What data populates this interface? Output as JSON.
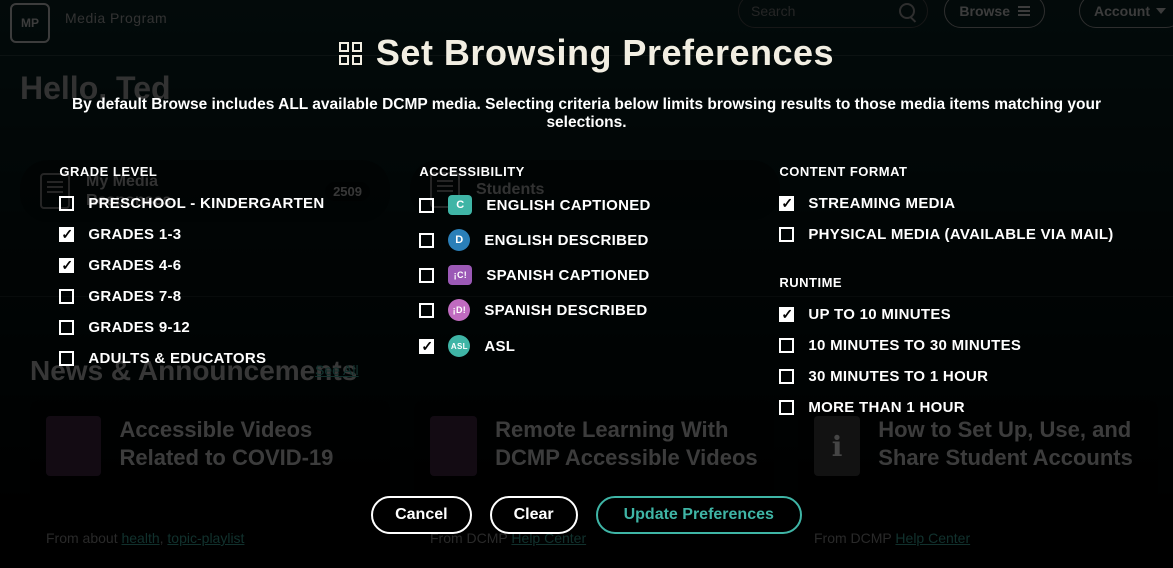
{
  "bg": {
    "logo_text": "MP",
    "brand": "Media Program",
    "search_placeholder": "Search",
    "browse": "Browse",
    "account": "Account",
    "hello": "Hello, Ted",
    "myMedia": {
      "title": "My Media\nResponses",
      "badge": "2509"
    },
    "students": "Students",
    "news_heading": "News & Announcements",
    "see_all": "See All",
    "cards": [
      {
        "title": "Accessible Videos Related to COVID-19",
        "meta_prefix": "From about ",
        "links": [
          "health",
          "topic-playlist"
        ]
      },
      {
        "title": "Remote Learning With DCMP Accessible Videos",
        "meta_prefix": "From DCMP ",
        "links": [
          "Help Center"
        ]
      },
      {
        "title": "How to Set Up, Use, and Share Student Accounts",
        "meta_prefix": "From DCMP ",
        "links": [
          "Help Center"
        ]
      }
    ]
  },
  "modal": {
    "title": "Set Browsing Preferences",
    "description": "By default Browse includes ALL available DCMP media. Selecting criteria below limits browsing results to those media items matching your selections.",
    "grade_level": {
      "heading": "GRADE LEVEL",
      "options": [
        {
          "label": "PRESCHOOL - KINDERGARTEN",
          "checked": false
        },
        {
          "label": "GRADES 1-3",
          "checked": true
        },
        {
          "label": "GRADES 4-6",
          "checked": true
        },
        {
          "label": "GRADES 7-8",
          "checked": false
        },
        {
          "label": "GRADES 9-12",
          "checked": false
        },
        {
          "label": "ADULTS & EDUCATORS",
          "checked": false
        }
      ]
    },
    "accessibility": {
      "heading": "ACCESSIBILITY",
      "options": [
        {
          "label": "ENGLISH CAPTIONED",
          "checked": false,
          "badge": "C",
          "badgeClass": "badge-c"
        },
        {
          "label": "ENGLISH DESCRIBED",
          "checked": false,
          "badge": "D",
          "badgeClass": "badge-d round"
        },
        {
          "label": "SPANISH CAPTIONED",
          "checked": false,
          "badge": "¡C!",
          "badgeClass": "badge-sc"
        },
        {
          "label": "SPANISH DESCRIBED",
          "checked": false,
          "badge": "¡D!",
          "badgeClass": "badge-sd round"
        },
        {
          "label": "ASL",
          "checked": true,
          "badge": "ASL",
          "badgeClass": "badge-asl round"
        }
      ]
    },
    "content_format": {
      "heading": "CONTENT FORMAT",
      "options": [
        {
          "label": "STREAMING MEDIA",
          "checked": true
        },
        {
          "label": "PHYSICAL MEDIA (AVAILABLE VIA MAIL)",
          "checked": false
        }
      ]
    },
    "runtime": {
      "heading": "RUNTIME",
      "options": [
        {
          "label": "UP TO 10 MINUTES",
          "checked": true
        },
        {
          "label": "10 MINUTES TO 30 MINUTES",
          "checked": false
        },
        {
          "label": "30 MINUTES TO 1 HOUR",
          "checked": false
        },
        {
          "label": "MORE THAN 1 HOUR",
          "checked": false
        }
      ]
    },
    "buttons": {
      "cancel": "Cancel",
      "clear": "Clear",
      "update": "Update Preferences"
    }
  }
}
